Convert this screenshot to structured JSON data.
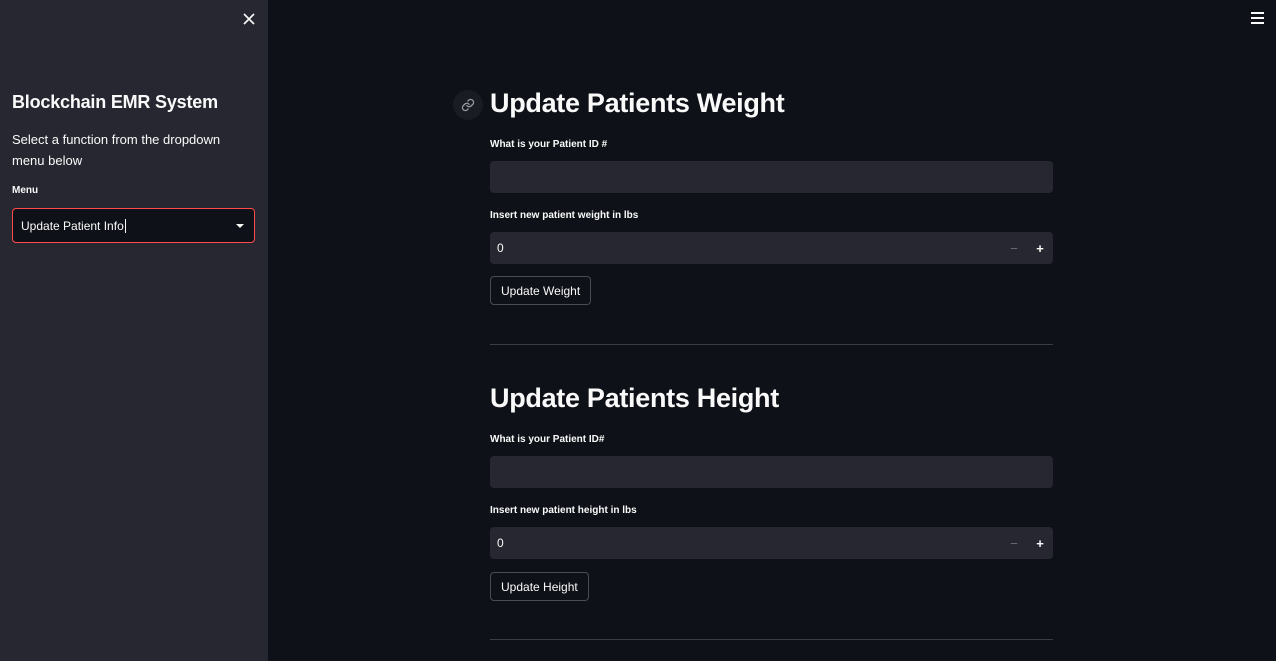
{
  "sidebar": {
    "close_icon": "close-icon",
    "title": "Blockchain EMR System",
    "description": "Select a function from the dropdown menu below",
    "menu_label": "Menu",
    "menu_selected": "Update Patient Info",
    "accent_color": "#ff4b4b"
  },
  "header": {
    "menu_icon": "hamburger-icon"
  },
  "weight_section": {
    "title": "Update Patients Weight",
    "anchor_icon": "link-icon",
    "id_label": "What is your Patient ID #",
    "id_value": "",
    "weight_label": "Insert new patient weight in lbs",
    "weight_value": "0",
    "minus_label": "−",
    "plus_label": "+",
    "button_label": "Update Weight"
  },
  "height_section": {
    "title": "Update Patients Height",
    "id_label": "What is your Patient ID#",
    "id_value": "",
    "height_label": "Insert new patient height in lbs",
    "height_value": "0",
    "minus_label": "−",
    "plus_label": "+",
    "button_label": "Update Height"
  },
  "colors": {
    "background": "#0e1117",
    "sidebar": "#262730",
    "input": "#262730",
    "text": "#fafafa"
  }
}
